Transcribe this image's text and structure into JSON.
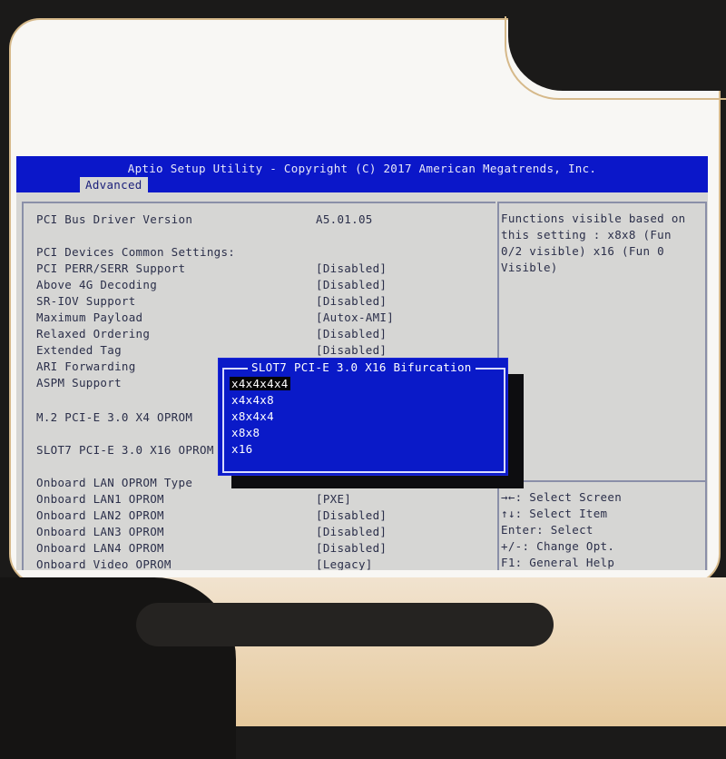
{
  "header": {
    "title": "Aptio Setup Utility - Copyright (C) 2017 American Megatrends, Inc.",
    "active_tab": "Advanced"
  },
  "settings": [
    {
      "label": "PCI Bus Driver Version",
      "value": "A5.01.05"
    },
    {
      "label": "PCI Devices Common Settings:",
      "value": ""
    },
    {
      "label": "PCI PERR/SERR Support",
      "value": "[Disabled]"
    },
    {
      "label": "Above 4G Decoding",
      "value": "[Disabled]"
    },
    {
      "label": "SR-IOV Support",
      "value": "[Disabled]"
    },
    {
      "label": "Maximum Payload",
      "value": "[Autox-AMI]"
    },
    {
      "label": "Relaxed Ordering",
      "value": "[Disabled]"
    },
    {
      "label": "Extended Tag",
      "value": "[Disabled]"
    },
    {
      "label": "ARI Forwarding",
      "value": ""
    },
    {
      "label": "ASPM Support",
      "value": ""
    },
    {
      "label": "M.2 PCI-E 3.0 X4 OPROM",
      "value": ""
    },
    {
      "label": "SLOT7 PCI-E 3.0 X16 OPROM",
      "value": ""
    },
    {
      "label": "Onboard LAN OPROM Type",
      "value": ""
    },
    {
      "label": "Onboard LAN1 OPROM",
      "value": "[PXE]"
    },
    {
      "label": "Onboard LAN2 OPROM",
      "value": "[Disabled]"
    },
    {
      "label": "Onboard LAN3 OPROM",
      "value": "[Disabled]"
    },
    {
      "label": "Onboard LAN4 OPROM",
      "value": "[Disabled]"
    },
    {
      "label": "Onboard Video OPROM",
      "value": "[Legacy]"
    }
  ],
  "help": {
    "text": "Functions visible based on this setting : x8x8 (Fun 0/2 visible) x16 (Fun 0 Visible)",
    "keys": [
      "→←: Select Screen",
      "↑↓: Select Item",
      "Enter: Select",
      "+/-: Change Opt.",
      "F1: General Help"
    ]
  },
  "popup": {
    "title": "SLOT7 PCI-E 3.0 X16 Bifurcation",
    "options": [
      "x4x4x4x4",
      "x4x4x8",
      "x8x4x4",
      "x8x8",
      "x16"
    ],
    "selected": "x4x4x4x4"
  },
  "colors": {
    "header_blue": "#0b17c9",
    "popup_blue": "#0a1ac8",
    "screen_bg": "#d6d6d4",
    "text": "#2b2f4a"
  }
}
